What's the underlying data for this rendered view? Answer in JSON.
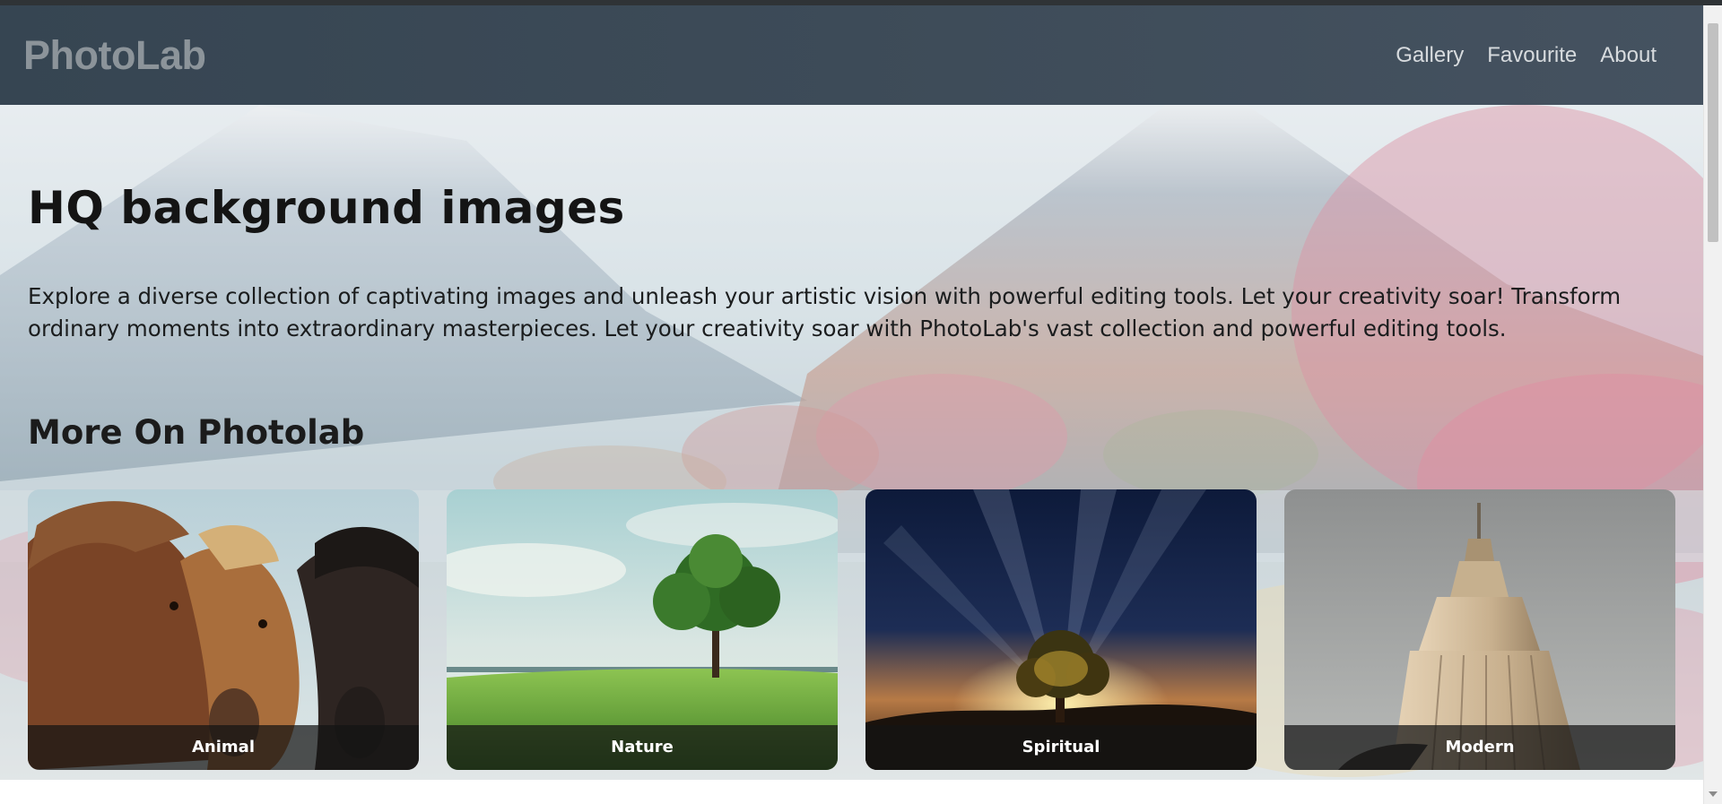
{
  "header": {
    "brand": "PhotoLab",
    "nav": [
      {
        "label": "Gallery"
      },
      {
        "label": "Favourite"
      },
      {
        "label": "About"
      }
    ]
  },
  "hero": {
    "title": "HQ background images",
    "description": "Explore a diverse collection of captivating images and unleash your artistic vision with powerful editing tools. Let your creativity soar! Transform ordinary moments into extraordinary masterpieces. Let your creativity soar with PhotoLab's vast collection and powerful editing tools.",
    "subtitle": "More On Photolab"
  },
  "categories": [
    {
      "label": "Animal",
      "image": "horses-photo"
    },
    {
      "label": "Nature",
      "image": "tree-field-photo"
    },
    {
      "label": "Spiritual",
      "image": "sunrise-tree-photo"
    },
    {
      "label": "Modern",
      "image": "skyscraper-photo"
    }
  ],
  "colors": {
    "navbar": "#3d4b58",
    "brand": "#8c949a",
    "nav_link": "#d7dbde",
    "caption_bg": "#141414"
  }
}
